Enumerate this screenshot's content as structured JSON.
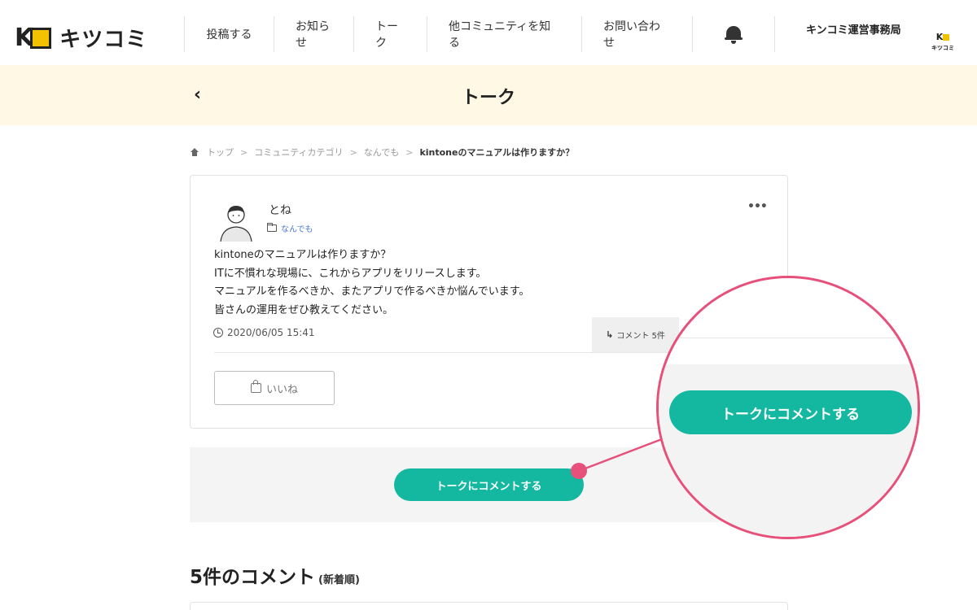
{
  "header": {
    "logo_text": "キツコミ",
    "nav": [
      {
        "label": "投稿する"
      },
      {
        "label": "お知らせ"
      },
      {
        "label": "トーク"
      },
      {
        "label": "他コミュニティを知る"
      },
      {
        "label": "お問い合わせ"
      }
    ],
    "bell_icon": "bell-icon",
    "org_name": "キンコミ運営事務局",
    "org_logo_text": "キツコミ"
  },
  "title_band": {
    "back_icon": "‹",
    "title": "トーク"
  },
  "breadcrumb": {
    "items": [
      "トップ",
      "コミュニティカテゴリ",
      "なんでも",
      "kintoneのマニュアルは作りますか？"
    ],
    "separator": ">"
  },
  "post": {
    "author": "とね",
    "category": "なんでも",
    "more": "•••",
    "body": [
      "kintoneのマニュアルは作りますか？",
      "ITに不慣れな現場に、これからアプリをリリースします。",
      "マニュアルを作るべきか、またアプリで作るべきか悩んでいます。",
      "皆さんの運用をぜひ教えてください。"
    ],
    "date": "2020/06/05 15:41",
    "comment_tab": "コメント 5件",
    "like_label": "いいね"
  },
  "actions": {
    "comment_button": "トークにコメントする",
    "zoom_comment_button": "トークにコメントする"
  },
  "comments": {
    "heading": "5件のコメント",
    "order": "(新着順)"
  },
  "colors": {
    "accent": "#14b8a0",
    "highlight": "#e6507a",
    "band": "#fef8e4",
    "logo_yellow": "#f2c200"
  }
}
